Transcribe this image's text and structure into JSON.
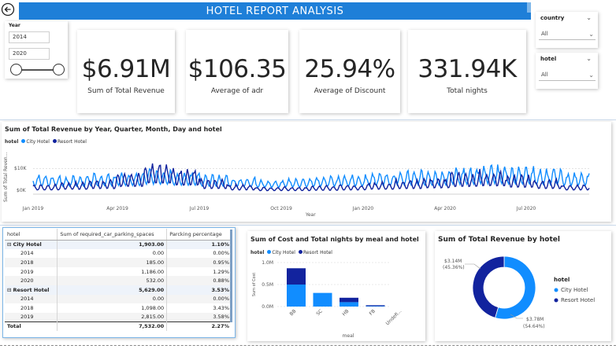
{
  "header": {
    "title": "HOTEL REPORT ANALYSIS",
    "back_icon": "back-arrow-icon"
  },
  "year_slicer": {
    "label": "Year",
    "start": "2014",
    "end": "2020",
    "range": [
      2014,
      2020
    ]
  },
  "kpis": [
    {
      "value": "$6.91M",
      "caption": "Sum of Total Revenue"
    },
    {
      "value": "$106.35",
      "caption": "Average of adr"
    },
    {
      "value": "25.94%",
      "caption": "Average of Discount"
    },
    {
      "value": "331.94K",
      "caption": "Total nights"
    }
  ],
  "country_slicer": {
    "label": "country",
    "value": "All"
  },
  "hotel_slicer": {
    "label": "hotel",
    "value": "All"
  },
  "colors": {
    "city": "#118dff",
    "resort": "#12239e",
    "accent": "#1e7fd8"
  },
  "revenue_line": {
    "title": "Sum of Total Revenue by Year, Quarter, Month, Day and hotel",
    "legend_title": "hotel",
    "ylabel": "Sum of Total Reven...",
    "xlabel": "Year",
    "yticks": [
      "$10K",
      "$0K"
    ]
  },
  "pivot_table": {
    "headers": [
      "hotel",
      "Sum of required_car_parking_spaces",
      "Parcking percentage"
    ],
    "rows": [
      {
        "label": "City Hotel",
        "sum": "1,903.00",
        "pct": "1.10%",
        "group": true
      },
      {
        "label": "2014",
        "sum": "0.00",
        "pct": "0.00%"
      },
      {
        "label": "2018",
        "sum": "185.00",
        "pct": "0.95%"
      },
      {
        "label": "2019",
        "sum": "1,186.00",
        "pct": "1.29%"
      },
      {
        "label": "2020",
        "sum": "532.00",
        "pct": "0.88%"
      },
      {
        "label": "Resort Hotel",
        "sum": "5,629.00",
        "pct": "3.53%",
        "group": true
      },
      {
        "label": "2014",
        "sum": "0.00",
        "pct": "0.00%"
      },
      {
        "label": "2018",
        "sum": "1,098.00",
        "pct": "3.43%"
      },
      {
        "label": "2019",
        "sum": "2,815.00",
        "pct": "3.58%"
      }
    ],
    "total": {
      "label": "Total",
      "sum": "7,532.00",
      "pct": "2.27%"
    }
  },
  "chart_data": [
    {
      "type": "line",
      "title": "Sum of Total Revenue by Year, Quarter, Month, Day and hotel",
      "xlabel": "Year",
      "ylabel": "Sum of Total Reven...",
      "x_ticks": [
        "Jan 2019",
        "Apr 2019",
        "Jul 2019",
        "Oct 2019",
        "Jan 2020",
        "Apr 2020",
        "Jul 2020"
      ],
      "y_ticks": [
        "$0K",
        "$10K"
      ],
      "ylim": [
        0,
        16000
      ],
      "series": [
        {
          "name": "City Hotel",
          "color": "#118dff",
          "monthly_peak": [
            8000,
            7500,
            8500,
            9000,
            11000,
            9500,
            8000,
            7000,
            6000,
            6500,
            7500,
            8000,
            9000,
            10000,
            9500,
            11000,
            12000,
            11500,
            10500,
            9000
          ]
        },
        {
          "name": "Resort Hotel",
          "color": "#12239e",
          "monthly_peak": [
            4000,
            5000,
            6000,
            9000,
            14000,
            11000,
            6000,
            4000,
            3000,
            3000,
            3500,
            4000,
            5000,
            6000,
            7000,
            9000,
            10000,
            8000,
            6000,
            4000
          ]
        }
      ],
      "legend": "top-left"
    },
    {
      "type": "bar",
      "title": "Sum of Cost and Total nights by meal and hotel",
      "xlabel": "meal",
      "ylabel": "Sum of Cost",
      "categories": [
        "BB",
        "SC",
        "HB",
        "FB",
        "Undefi..."
      ],
      "y_ticks": [
        "0.0M",
        "0.5M",
        "1.0M"
      ],
      "ylim": [
        0,
        1.0
      ],
      "stacked": true,
      "series": [
        {
          "name": "City Hotel",
          "color": "#118dff",
          "values": [
            0.5,
            0.31,
            0.1,
            0.01,
            0.0
          ]
        },
        {
          "name": "Resort Hotel",
          "color": "#12239e",
          "values": [
            0.37,
            0.0,
            0.1,
            0.02,
            0.0
          ]
        }
      ],
      "legend": "top-left"
    },
    {
      "type": "pie",
      "title": "Sum of Total Revenue by hotel",
      "donut": true,
      "slices": [
        {
          "name": "City Hotel",
          "value": 3.78,
          "label": "$3.78M",
          "pct_label": "(54.64%)",
          "color": "#118dff"
        },
        {
          "name": "Resort Hotel",
          "value": 3.14,
          "label": "$3.14M",
          "pct_label": "(45.36%)",
          "color": "#12239e"
        }
      ],
      "legend_title": "hotel",
      "legend": "right"
    }
  ]
}
